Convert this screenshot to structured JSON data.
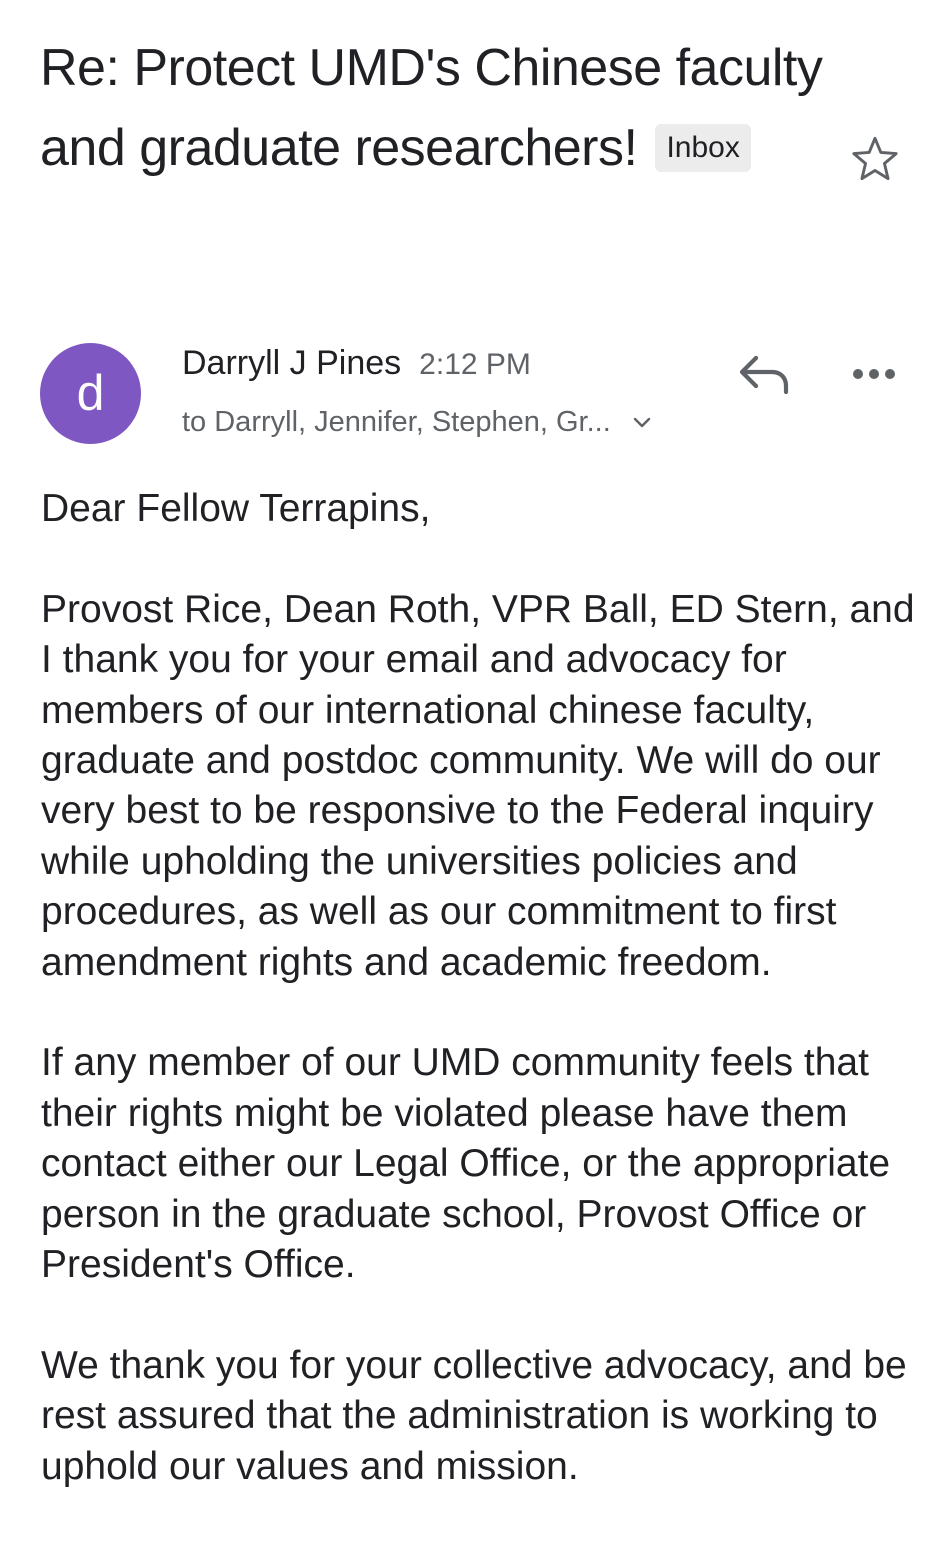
{
  "email": {
    "subject": "Re: Protect UMD's Chinese faculty and graduate researchers!",
    "label_badge": "Inbox",
    "sender": {
      "avatar_letter": "d",
      "avatar_color": "#7e57c2",
      "name": "Darryll J Pines",
      "time": "2:12 PM",
      "recipients": "to Darryll, Jennifer, Stephen, Gr..."
    },
    "body": {
      "greeting": "Dear Fellow Terrapins,",
      "paragraph_1": "Provost Rice, Dean Roth, VPR Ball, ED Stern, and I thank you for your email and advocacy for members of our international chinese faculty, graduate and postdoc community. We will do our very best to be responsive to the Federal inquiry while upholding the universities policies and procedures, as well as our commitment to first amendment rights and academic freedom.",
      "paragraph_2": "If any member of our UMD community feels that their rights might be violated please have them contact either our Legal Office, or the appropriate person in the graduate school, Provost Office or President's Office.",
      "paragraph_3": "We thank you for your collective advocacy, and be rest assured that the administration is working to uphold our values and mission."
    }
  },
  "icons": {
    "star": "star-outline-icon",
    "reply": "reply-arrow-icon",
    "more": "more-horizontal-icon",
    "expand": "chevron-down-icon"
  }
}
